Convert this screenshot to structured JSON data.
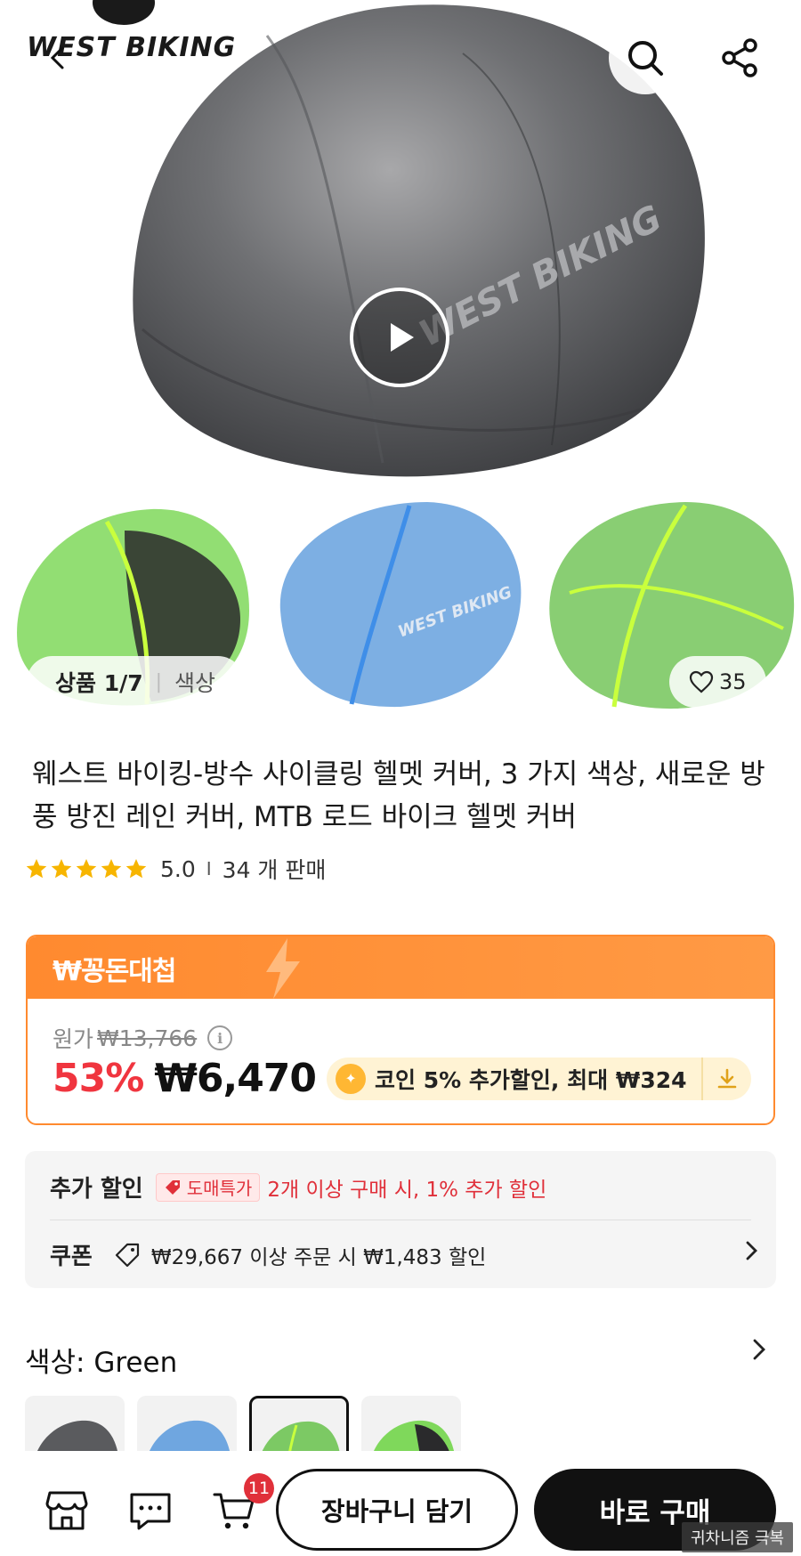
{
  "hero": {
    "brand_logo": "WEST BIKING",
    "helmet_print": "WEST BIKING"
  },
  "gallery": {
    "counter_label": "상품 1/7",
    "counter_sub": "색상",
    "likes": "35"
  },
  "product": {
    "title": "웨스트 바이킹-방수 사이클링 헬멧 커버, 3 가지 색상, 새로운 방풍 방진 레인 커버, MTB 로드 바이크 헬멧 커버",
    "rating": "5.0",
    "sold": "34 개 판매",
    "star_color": "#f7b500"
  },
  "price": {
    "banner": "₩꽁돈대첩",
    "original_label": "원가",
    "original_price": "₩13,766",
    "discount": "53%",
    "sale_price": "₩6,470",
    "coin_offer": "코인 5% 추가할인, 최대 ₩324",
    "accent": "#ff8a2f"
  },
  "extra": {
    "label": "추가 할인",
    "wholesale_tag": "도매특가",
    "wholesale_text": "2개 이상 구매 시, 1% 추가 할인",
    "coupon_label": "쿠폰",
    "coupon_text": "₩29,667 이상 주문 시 ₩1,483 할인"
  },
  "color": {
    "heading": "색상: Green",
    "swatches": [
      "Gray",
      "Blue",
      "Green",
      "Green/Black"
    ],
    "selected": "Green"
  },
  "bottom": {
    "cart_count": "11",
    "add_to_cart": "장바구니 담기",
    "buy_now": "바로 구매",
    "watermark": "귀차니즘 극복"
  }
}
